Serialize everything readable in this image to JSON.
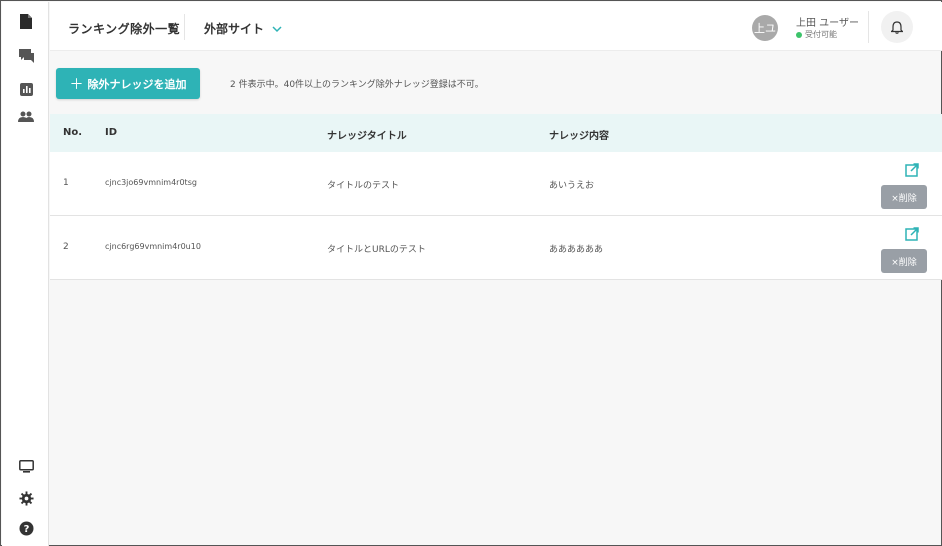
{
  "header": {
    "page_title": "ランキング除外一覧",
    "site_select": "外部サイト",
    "avatar_initials": "上ユ",
    "user_name": "上田 ユーザー",
    "user_status": "受付可能"
  },
  "toolbar": {
    "add_label": "除外ナレッジを追加",
    "info_text": "2 件表示中。40件以上のランキング除外ナレッジ登録は不可。"
  },
  "table": {
    "headers": {
      "no": "No.",
      "id": "ID",
      "title": "ナレッジタイトル",
      "content": "ナレッジ内容"
    },
    "rows": [
      {
        "no": "1",
        "id": "cjnc3jo69vmnim4r0tsg",
        "title": "タイトルのテスト",
        "content": "あいうえお",
        "delete_label": "×削除"
      },
      {
        "no": "2",
        "id": "cjnc6rg69vmnim4r0u10",
        "title": "タイトルとURLのテスト",
        "content": "ああああああ",
        "delete_label": "×削除"
      }
    ]
  },
  "colors": {
    "accent": "#2eb3b6",
    "table_header_bg": "#e9f6f6",
    "delete_button": "#999fa6",
    "status_online": "#3cc36a"
  },
  "icons": {
    "sidebar_top": [
      "document-icon",
      "chat-icon",
      "chart-icon",
      "users-icon"
    ],
    "sidebar_bottom": [
      "monitor-icon",
      "gear-icon",
      "help-icon"
    ]
  }
}
